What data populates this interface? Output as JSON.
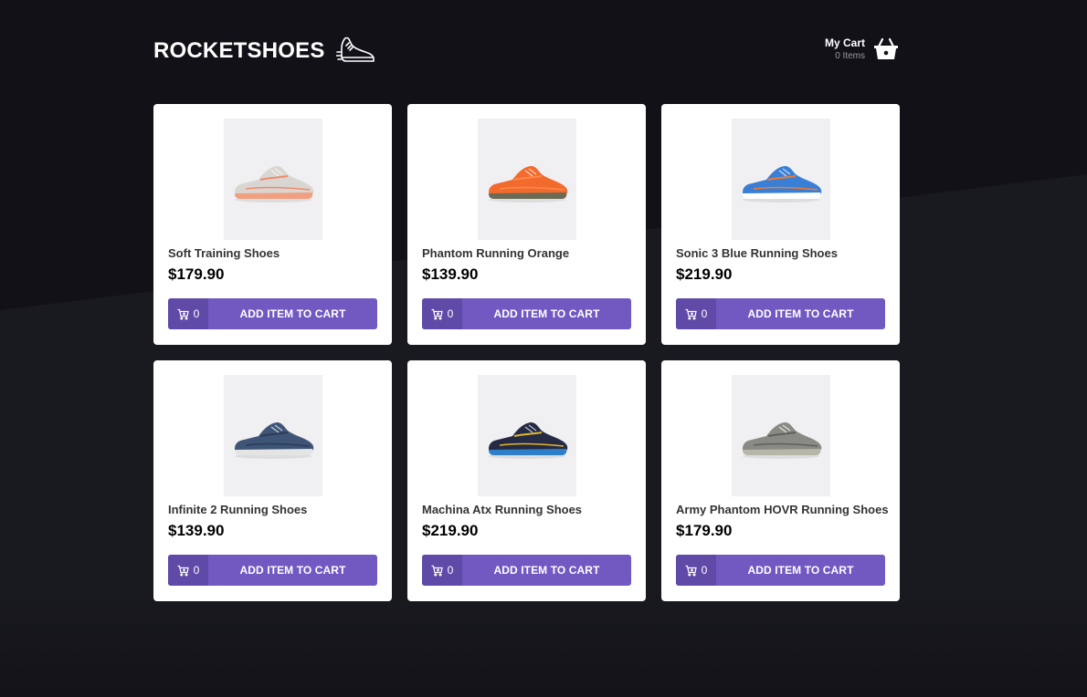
{
  "header": {
    "logo_text": "ROCKETSHOES",
    "cart_title": "My Cart",
    "cart_count": "0 Items"
  },
  "products": [
    {
      "name": "Soft Training Shoes",
      "price": "$179.90",
      "amount": "0",
      "button_label": "ADD ITEM TO CART",
      "shoe_color": "#d9d6d2",
      "accent": "#f08a6a",
      "sole": "#f0a080"
    },
    {
      "name": "Phantom Running Orange",
      "price": "$139.90",
      "amount": "0",
      "button_label": "ADD ITEM TO CART",
      "shoe_color": "#f26a2c",
      "accent": "#ff8a4a",
      "sole": "#6b6b55"
    },
    {
      "name": "Sonic 3 Blue Running Shoes",
      "price": "$219.90",
      "amount": "0",
      "button_label": "ADD ITEM TO CART",
      "shoe_color": "#3a7fd6",
      "accent": "#f07a30",
      "sole": "#ffffff"
    },
    {
      "name": "Infinite 2 Running Shoes",
      "price": "$139.90",
      "amount": "0",
      "button_label": "ADD ITEM TO CART",
      "shoe_color": "#3f5577",
      "accent": "#2c3c58",
      "sole": "#e4e4e4"
    },
    {
      "name": "Machina Atx Running Shoes",
      "price": "$219.90",
      "amount": "0",
      "button_label": "ADD ITEM TO CART",
      "shoe_color": "#262b45",
      "accent": "#e2b52a",
      "sole": "#2e7fc9"
    },
    {
      "name": "Army Phantom HOVR Running Shoes",
      "price": "$179.90",
      "amount": "0",
      "button_label": "ADD ITEM TO CART",
      "shoe_color": "#8a8a84",
      "accent": "#5f605a",
      "sole": "#b8b6a8"
    }
  ],
  "colors": {
    "background": "#191920",
    "button": "#7159c1",
    "button_dark": "#5f4aa8"
  }
}
